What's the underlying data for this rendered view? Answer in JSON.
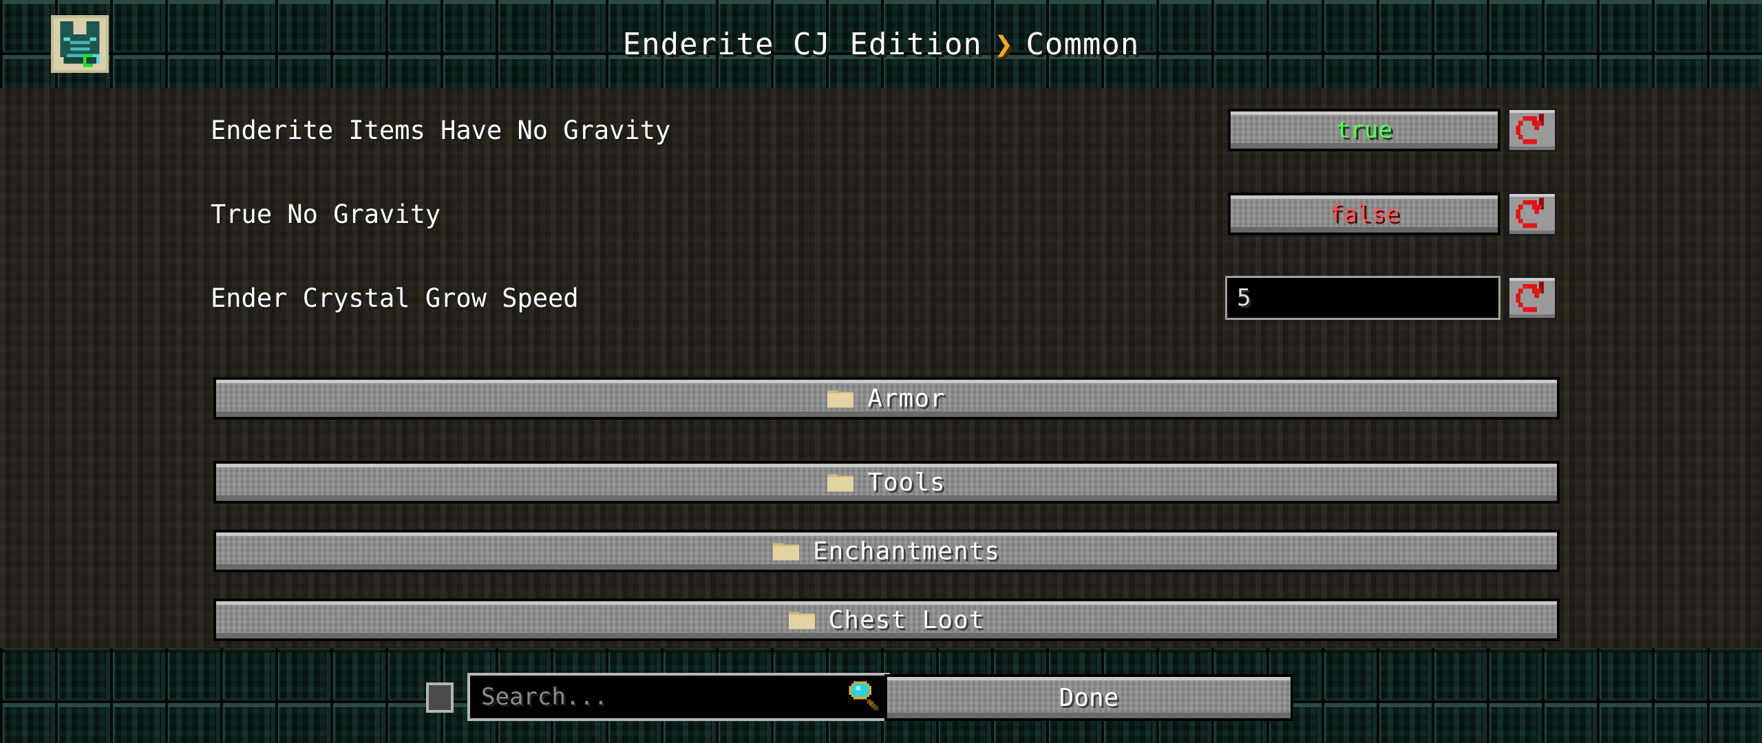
{
  "window": {
    "title": "Enderite CJ Edition",
    "separator": "❯",
    "subtitle": "Common",
    "mod_icon_name": "enderite-chestplate-icon"
  },
  "theme": {
    "header_bg": "#061310",
    "content_bg": "#24221a",
    "button_face": "#8b8b8b",
    "button_border": "#000000",
    "accent_chevron": "#f5a623",
    "value_true": "#55ff55",
    "value_false": "#ff5555",
    "reset_icon": "#e01616",
    "folder_icon": "#e3d2a2",
    "text": "#ffffff",
    "placeholder": "#8a8a8a"
  },
  "settings": [
    {
      "label": "Enderite Items Have No Gravity",
      "control": "toggle",
      "value": "true",
      "value_state": "true",
      "reset_label": "reset-icon"
    },
    {
      "label": "True No Gravity",
      "control": "toggle",
      "value": "false",
      "value_state": "false",
      "reset_label": "reset-icon"
    },
    {
      "label": "Ender Crystal Grow Speed",
      "control": "number",
      "value": "5",
      "reset_label": "reset-icon"
    }
  ],
  "categories": [
    {
      "label": "Armor",
      "icon": "folder-icon"
    },
    {
      "label": "Tools",
      "icon": "folder-icon"
    },
    {
      "label": "Enchantments",
      "icon": "folder-icon"
    },
    {
      "label": "Chest Loot",
      "icon": "folder-icon"
    }
  ],
  "footer": {
    "filter_checkbox_checked": "false",
    "search_placeholder": "Search...",
    "search_value": "",
    "search_icon": "magnifying-glass-icon",
    "done_label": "Done"
  }
}
